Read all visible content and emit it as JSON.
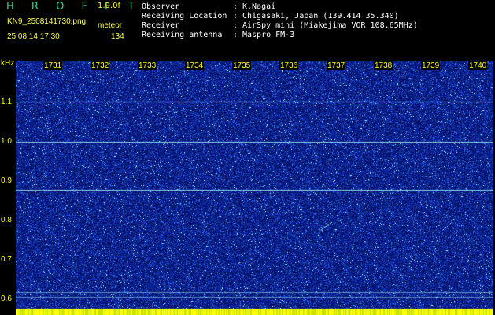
{
  "app": {
    "logo": "H R O F F T",
    "version": "1.0.0f",
    "filename": "KN9_2508141730.png",
    "mode": "meteor",
    "datetime": "25.08.14 17:30",
    "counter": "134"
  },
  "info": [
    {
      "label": "Observer",
      "value": "K.Nagai"
    },
    {
      "label": "Receiving Location",
      "value": "Chigasaki, Japan (139.414 35.340)"
    },
    {
      "label": "Receiver",
      "value": "AirSpy mini (Miakejima VOR 108.65MHz)"
    },
    {
      "label": "Receiving antenna",
      "value": "Maspro FM-3"
    }
  ],
  "separator": ":",
  "spectrogram": {
    "y_unit": "kHz",
    "y_ticks": [
      "1.1",
      "1.0",
      "0.9",
      "0.8",
      "0.7",
      "0.6"
    ],
    "x_ticks": [
      "1731",
      "1732",
      "1733",
      "1734",
      "1735",
      "1736",
      "1737",
      "1738",
      "1739",
      "1740"
    ],
    "colors": {
      "background": "#0a1a6a",
      "noise": "#2a5cff",
      "signal": "#8ff0ff",
      "label": "#ffff00"
    }
  }
}
